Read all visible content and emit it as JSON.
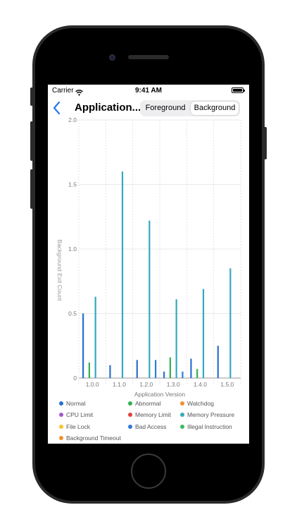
{
  "status_bar": {
    "carrier": "Carrier",
    "time": "9:41 AM"
  },
  "nav": {
    "title": "Application...",
    "segments": [
      "Foreground",
      "Background"
    ],
    "selected_segment": "Background"
  },
  "colors": {
    "normal": "#2870cf",
    "abnormal": "#34b052",
    "watchdog": "#f0902c",
    "cpu_limit": "#a855d6",
    "memory_limit": "#e0423a",
    "memory_pressure": "#34a9bf",
    "file_lock": "#f5c530",
    "bad_access": "#2f7bd9",
    "illegal_instruction": "#3cba63",
    "background_timeout": "#f0902c"
  },
  "chart_data": {
    "type": "bar",
    "xlabel": "Application Version",
    "ylabel": "Background Exit Count",
    "ylim": [
      0,
      2
    ],
    "yticks": [
      "0",
      "0.5",
      "1.0",
      "1.5",
      "2.0"
    ],
    "categories": [
      "1.0.0",
      "1.1.0",
      "1.2.0",
      "1.3.0",
      "1.4.0",
      "1.5.0"
    ],
    "grid": true,
    "legend_position": "bottom",
    "series": [
      {
        "name": "Normal",
        "color": "#2870cf",
        "values": [
          0.5,
          0.1,
          0.14,
          0.05,
          0.15,
          0.25
        ]
      },
      {
        "name": "Abnormal",
        "color": "#34b052",
        "values": [
          0.12,
          0,
          0,
          0.16,
          0.07,
          0
        ]
      },
      {
        "name": "Watchdog",
        "color": "#f0902c",
        "values": [
          0,
          0,
          0,
          0,
          0,
          0
        ]
      },
      {
        "name": "CPU Limit",
        "color": "#a855d6",
        "values": [
          0,
          0,
          0,
          0,
          0,
          0
        ]
      },
      {
        "name": "Memory Limit",
        "color": "#e0423a",
        "values": [
          0,
          0,
          0,
          0,
          0,
          0
        ]
      },
      {
        "name": "Memory Pressure",
        "color": "#34a9bf",
        "values": [
          0.63,
          1.6,
          1.22,
          0.61,
          0.69,
          0.85
        ]
      },
      {
        "name": "File Lock",
        "color": "#f5c530",
        "values": [
          0,
          0,
          0,
          0,
          0,
          0
        ]
      },
      {
        "name": "Bad Access",
        "color": "#2f7bd9",
        "values": [
          0,
          0,
          0.14,
          0.05,
          0,
          0
        ]
      },
      {
        "name": "Illegal Instruction",
        "color": "#3cba63",
        "values": [
          0,
          0,
          0,
          0,
          0,
          0
        ]
      },
      {
        "name": "Background Timeout",
        "color": "#f0902c",
        "values": [
          0,
          0,
          0,
          0,
          0,
          0
        ]
      }
    ]
  }
}
